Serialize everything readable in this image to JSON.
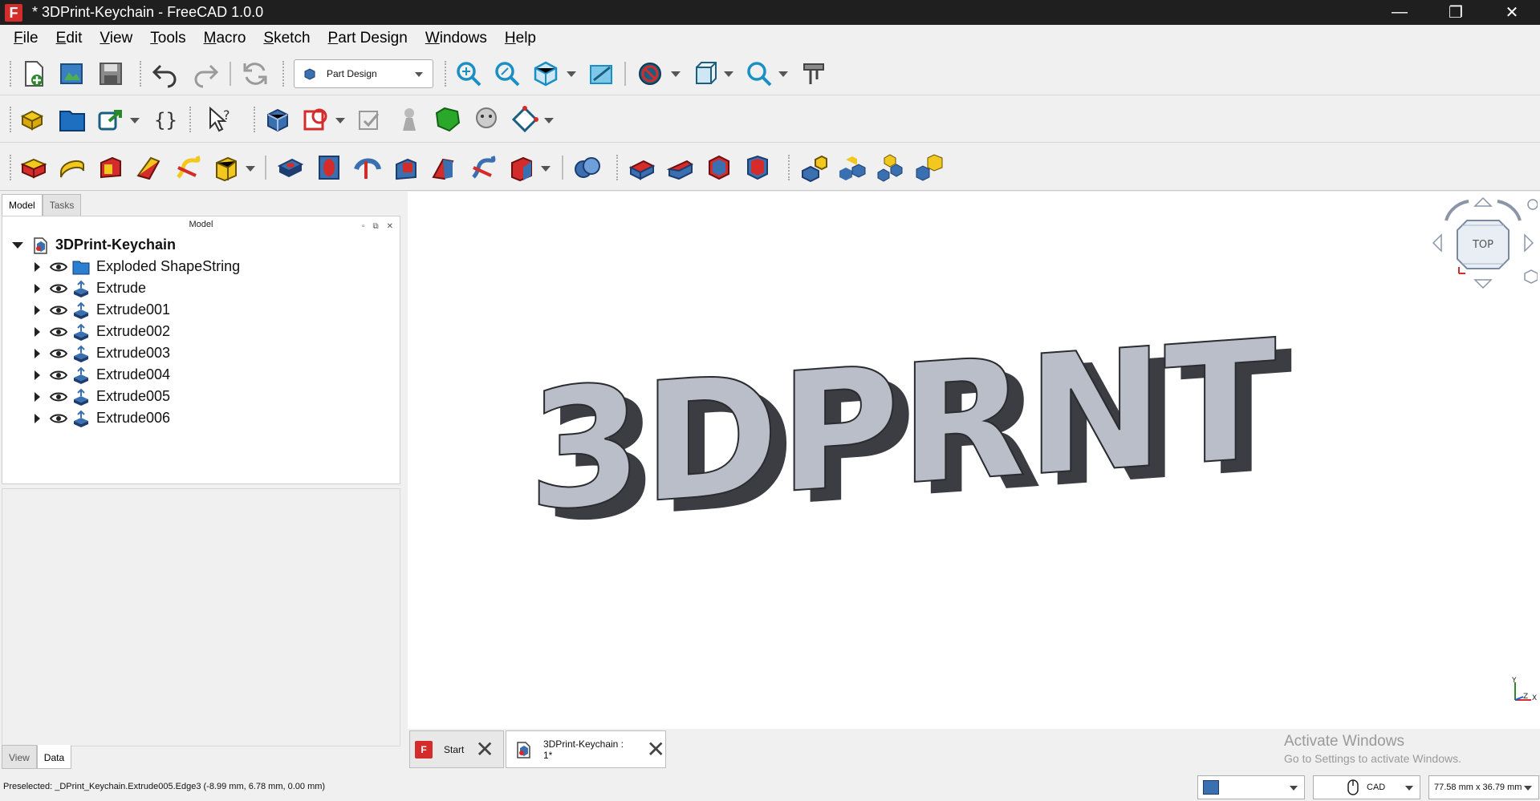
{
  "window": {
    "title": "* 3DPrint-Keychain - FreeCAD 1.0.0",
    "logo_letter": "F",
    "minimize": "—",
    "restore": "❐",
    "close": "✕"
  },
  "menu": [
    "File",
    "Edit",
    "View",
    "Tools",
    "Macro",
    "Sketch",
    "Part Design",
    "Windows",
    "Help"
  ],
  "workbench": {
    "selected": "Part Design"
  },
  "left_panel": {
    "tabs": [
      "Model",
      "Tasks"
    ],
    "header": "Model",
    "header_buttons": [
      "▫",
      "⧉",
      "✕"
    ],
    "root": "3DPrint-Keychain",
    "items": [
      "Exploded ShapeString",
      "Extrude",
      "Extrude001",
      "Extrude002",
      "Extrude003",
      "Extrude004",
      "Extrude005",
      "Extrude006"
    ],
    "bottom_tabs": [
      "View",
      "Data"
    ]
  },
  "view": {
    "text3d": "3DPRNT",
    "nav_cube_face": "TOP",
    "axis_y": "Y",
    "axis_x": "X",
    "axis_z": "Z"
  },
  "doc_tabs": [
    {
      "label": "Start"
    },
    {
      "label": "3DPrint-Keychain : 1*"
    }
  ],
  "watermark": {
    "line1": "Activate Windows",
    "line2": "Go to Settings to activate Windows."
  },
  "status": {
    "preselected": "Preselected: _DPrint_Keychain.Extrude005.Edge3 (-8.99 mm, 6.78 mm, 0.00 mm)",
    "nav_style": "CAD",
    "dimensions": "77.58 mm x 36.79 mm"
  },
  "colors": {
    "titlebar": "#1f1f1f",
    "accent_blue": "#3a6fb0",
    "feature_yellow": "#f2c81e",
    "feature_red": "#d42b2b",
    "solid_face": "#b9bec9",
    "solid_side": "#3b3d42"
  }
}
